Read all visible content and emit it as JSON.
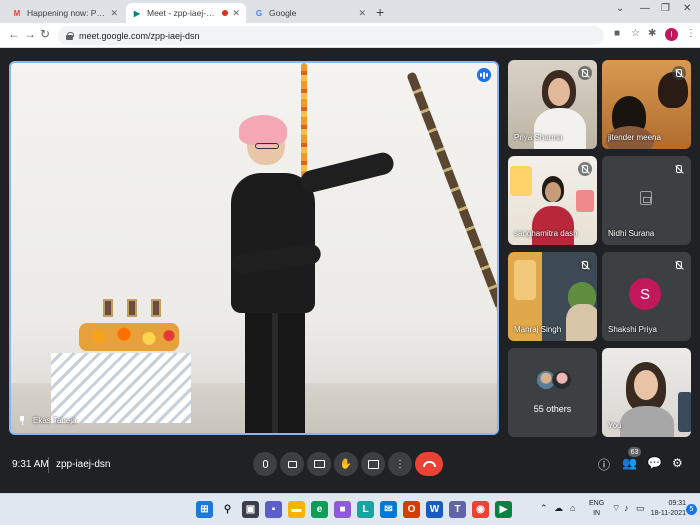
{
  "browser": {
    "tabs": [
      {
        "title": "Happening now: Priya Sharma is",
        "icon": "gmail-icon",
        "active": false
      },
      {
        "title": "Meet - zpp-iaej-dsn",
        "icon": "meet-icon",
        "active": true,
        "recording": true
      },
      {
        "title": "Google",
        "icon": "google-icon",
        "active": false
      }
    ],
    "url": "meet.google.com/zpp-iaej-dsn",
    "profile_initial": "I"
  },
  "meet": {
    "main_speaker": {
      "name": "Ekas Taneja",
      "pinned": true,
      "speaking": true
    },
    "participants": [
      {
        "name": "Priya Sharma",
        "muted": true,
        "video": true
      },
      {
        "name": "jitender meena",
        "muted": true,
        "video": true
      },
      {
        "name": "sanghamitra dash",
        "muted": true,
        "video": true
      },
      {
        "name": "Nidhi Surana",
        "muted": true,
        "video": false
      },
      {
        "name": "Manraj Singh",
        "muted": true,
        "video": true
      },
      {
        "name": "Shakshi Priya",
        "muted": true,
        "video": false,
        "avatar_letter": "S"
      },
      {
        "name": "55 others",
        "muted": false,
        "video": false
      },
      {
        "name": "You",
        "muted": false,
        "video": true
      }
    ],
    "bar": {
      "time": "9:31 AM",
      "meeting_code": "zpp-iaej-dsn",
      "participant_count": "63"
    }
  },
  "taskbar": {
    "language": [
      "ENG",
      "IN"
    ],
    "time": "09:31",
    "date": "18-11-2021",
    "notifications": "5"
  },
  "colors": {
    "accent": "#8ab4f8",
    "end_call": "#ea4335",
    "avatar": "#c2185b",
    "meet_bg": "#202124"
  }
}
